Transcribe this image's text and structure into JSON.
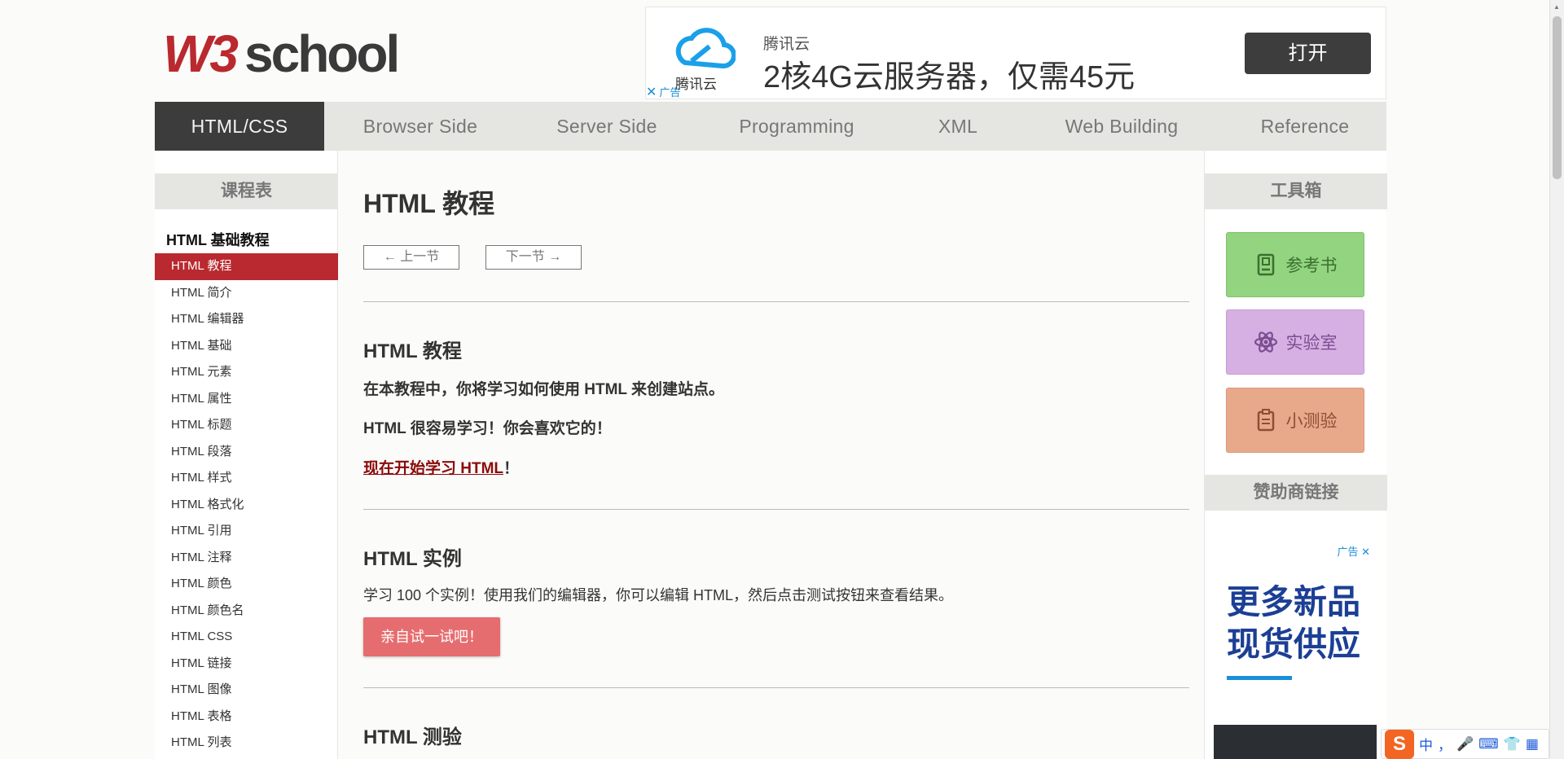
{
  "logo": {
    "text": "W3school",
    "w3": "W3",
    "rest": "school"
  },
  "ad_top": {
    "brand_small": "腾讯云",
    "cloud_label": "腾讯云",
    "headline": "2核4G云服务器，仅需45元",
    "button": "打开",
    "ad_mark": "广告",
    "close_glyph": "✕"
  },
  "nav": {
    "items": [
      {
        "label": "HTML/CSS",
        "active": true
      },
      {
        "label": "Browser Side"
      },
      {
        "label": "Server Side"
      },
      {
        "label": "Programming"
      },
      {
        "label": "XML"
      },
      {
        "label": "Web Building"
      },
      {
        "label": "Reference"
      }
    ]
  },
  "left": {
    "heading": "课程表",
    "group_title": "HTML 基础教程",
    "items": [
      "HTML 教程",
      "HTML 简介",
      "HTML 编辑器",
      "HTML 基础",
      "HTML 元素",
      "HTML 属性",
      "HTML 标题",
      "HTML 段落",
      "HTML 样式",
      "HTML 格式化",
      "HTML 引用",
      "HTML 注释",
      "HTML 颜色",
      "HTML 颜色名",
      "HTML CSS",
      "HTML 链接",
      "HTML 图像",
      "HTML 表格",
      "HTML 列表"
    ]
  },
  "main": {
    "title": "HTML 教程",
    "prev": "上一节",
    "next": "下一节",
    "s1": {
      "heading": "HTML 教程",
      "p1": "在本教程中，你将学习如何使用 HTML 来创建站点。",
      "p2": "HTML 很容易学习！你会喜欢它的！",
      "link": "现在开始学习 HTML",
      "link_suffix": "！"
    },
    "s2": {
      "heading": "HTML 实例",
      "p1": "学习 100 个实例！使用我们的编辑器，你可以编辑 HTML，然后点击测试按钮来查看结果。",
      "button": "亲自试一试吧！"
    },
    "s3": {
      "heading": "HTML 测验"
    }
  },
  "right": {
    "heading": "工具箱",
    "tools": [
      "参考书",
      "实验室",
      "小测验"
    ],
    "sponsor_heading": "赞助商链接",
    "ad": {
      "label": "广告",
      "close": "✕",
      "line1": "更多新品",
      "line2": "现货供应"
    }
  },
  "ime": {
    "logo": "S",
    "lang": "中"
  },
  "colors": {
    "accent_red": "#b9292f",
    "nav_active": "#3c3c3c",
    "link": "#8b0a0a"
  }
}
